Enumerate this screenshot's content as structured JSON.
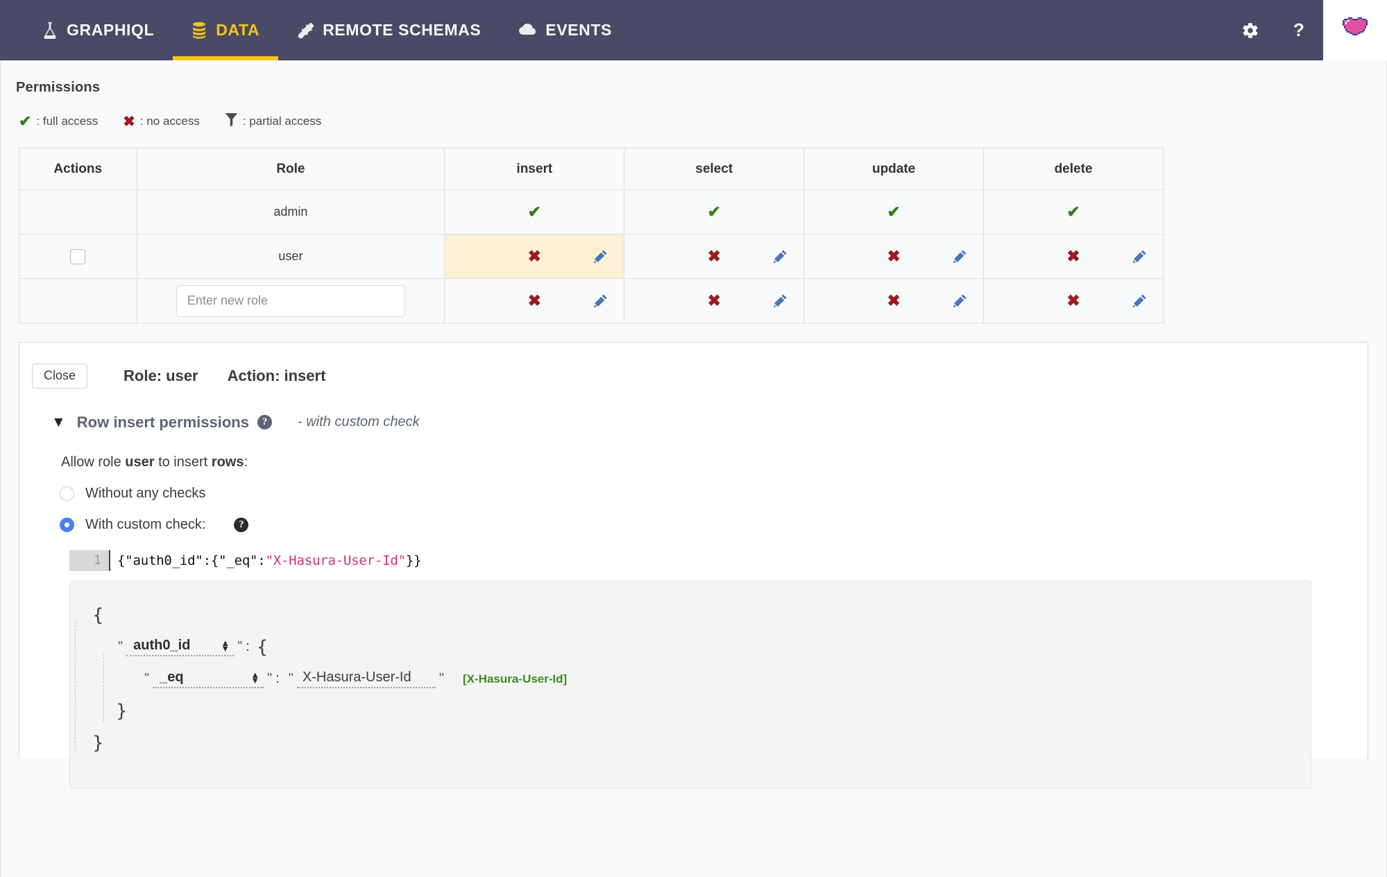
{
  "topnav": {
    "items": [
      {
        "label": "GraphiQL",
        "icon": "flask-icon",
        "active": false
      },
      {
        "label": "Data",
        "icon": "database-icon",
        "active": true
      },
      {
        "label": "Remote Schemas",
        "icon": "plug-icon",
        "active": false
      },
      {
        "label": "Events",
        "icon": "cloud-icon",
        "active": false
      }
    ],
    "settings_icon": "gear-icon",
    "help_label": "?",
    "avatar_icon": "heart-avatar-icon"
  },
  "permissions": {
    "title": "Permissions",
    "legend": [
      {
        "icon": "check-icon",
        "text": ": full access",
        "color": "#348017"
      },
      {
        "icon": "cross-icon",
        "text": ": no access",
        "color": "#9b1c1c"
      },
      {
        "icon": "filter-icon",
        "text": ": partial access",
        "color": "#4a4a4a"
      }
    ],
    "columns": [
      "Actions",
      "Role",
      "insert",
      "select",
      "update",
      "delete"
    ],
    "rows": [
      {
        "role": "admin",
        "has_checkbox": false,
        "is_input": false,
        "cells": [
          {
            "state": "full",
            "editable": false
          },
          {
            "state": "full",
            "editable": false
          },
          {
            "state": "full",
            "editable": false
          },
          {
            "state": "full",
            "editable": false
          }
        ]
      },
      {
        "role": "user",
        "has_checkbox": true,
        "is_input": false,
        "cells": [
          {
            "state": "none",
            "editable": true,
            "highlighted": true
          },
          {
            "state": "none",
            "editable": true,
            "highlighted": false
          },
          {
            "state": "none",
            "editable": true,
            "highlighted": false
          },
          {
            "state": "none",
            "editable": true,
            "highlighted": false
          }
        ]
      },
      {
        "role": "",
        "role_placeholder": "Enter new role",
        "has_checkbox": false,
        "is_input": true,
        "cells": [
          {
            "state": "none",
            "editable": true,
            "highlighted": false
          },
          {
            "state": "none",
            "editable": true,
            "highlighted": false
          },
          {
            "state": "none",
            "editable": true,
            "highlighted": false
          },
          {
            "state": "none",
            "editable": true,
            "highlighted": false
          }
        ]
      }
    ],
    "marks": {
      "full": "✔",
      "none": "✖"
    }
  },
  "edit_panel": {
    "close_label": "Close",
    "role_line": "Role: user",
    "action_line": "Action: insert",
    "section": {
      "chevron": "▼",
      "title": "Row insert permissions",
      "help": "?",
      "subtitle": "- with custom check"
    },
    "allow": {
      "prefix": "Allow role ",
      "role": "user",
      "middle": " to insert ",
      "object": "rows",
      "suffix": ":"
    },
    "options": [
      {
        "label": "Without any checks",
        "selected": false,
        "has_help": false
      },
      {
        "label": "With custom check:",
        "selected": true,
        "has_help": true,
        "help": "?"
      }
    ],
    "code": {
      "line_number": "1",
      "prefix": "{\"auth0_id\":{\"_eq\":",
      "string": "\"X-Hasura-User-Id\"",
      "suffix": "}}"
    },
    "builder": {
      "open_brace": "{",
      "close_brace": "}",
      "quote": "\"",
      "colon": ":",
      "key_outer": "auth0_id",
      "key_inner": "_eq",
      "value_inner": "X-Hasura-User-Id",
      "session_var": "[X-Hasura-User-Id]",
      "inner_open_brace": "{",
      "inner_close_brace": "}"
    }
  },
  "colors": {
    "nav_bg": "#484a66",
    "accent_yellow": "#f5c518",
    "page_bg": "#f8f9fa",
    "highlight_cell": "#fcf1d4",
    "radio_blue": "#4a7ef0",
    "section_slate": "#5c6378",
    "string_pink": "#d6336c",
    "session_green": "#3e8a20"
  }
}
